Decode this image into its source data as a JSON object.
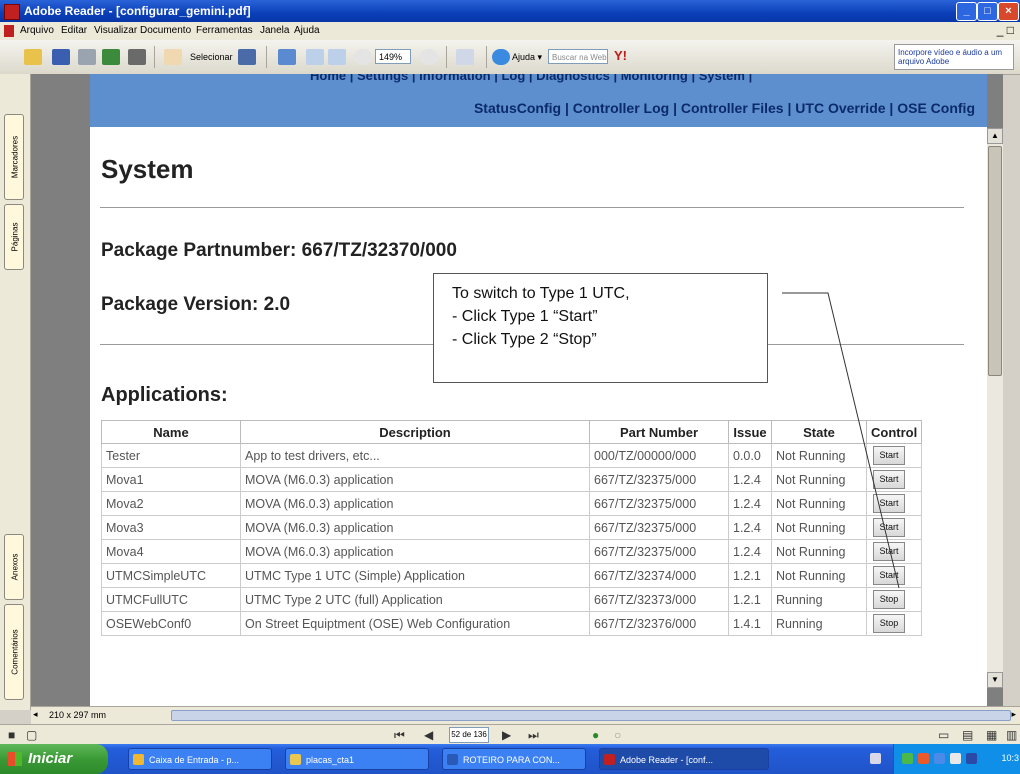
{
  "window": {
    "title": "Adobe Reader - [configurar_gemini.pdf]",
    "minimize": "_",
    "maximize": "□",
    "close": "×"
  },
  "menu": [
    "Arquivo",
    "Editar",
    "Visualizar",
    "Documento",
    "Ferramentas",
    "Janela",
    "Ajuda"
  ],
  "menu_mdi": "_ □",
  "toolbar": {
    "select_label": "Selecionar",
    "zoom_value": "149%",
    "help_label": "Ajuda",
    "search_placeholder": "Buscar na Web",
    "promo_text": "Incorpore vídeo e áudio a um arquivo Adobe"
  },
  "left_tabs": [
    "Marcadores",
    "Páginas",
    "Anexos",
    "Comentários"
  ],
  "page": {
    "nav_top": "Home | Settings | Information | Log | Diagnostics | Monitoring | System |",
    "nav_bottom": "StatusConfig | Controller Log | Controller Files | UTC Override | OSE Config",
    "title": "System",
    "package_partnumber": "Package Partnumber: 667/TZ/32370/000",
    "package_version": "Package Version: 2.0",
    "applications_heading": "Applications:",
    "callout": {
      "line1": "To switch to Type 1 UTC,",
      "line2": " - Click Type 1 “Start”",
      "line3": " - Click Type 2 “Stop”"
    },
    "table": {
      "headers": [
        "Name",
        "Description",
        "Part Number",
        "Issue",
        "State",
        "Control"
      ],
      "rows": [
        {
          "name": "Tester",
          "description": "App to test drivers, etc...",
          "part": "000/TZ/00000/000",
          "issue": "0.0.0",
          "state": "Not Running",
          "control": "Start"
        },
        {
          "name": "Mova1",
          "description": "MOVA (M6.0.3) application",
          "part": "667/TZ/32375/000",
          "issue": "1.2.4",
          "state": "Not Running",
          "control": "Start"
        },
        {
          "name": "Mova2",
          "description": "MOVA (M6.0.3) application",
          "part": "667/TZ/32375/000",
          "issue": "1.2.4",
          "state": "Not Running",
          "control": "Start"
        },
        {
          "name": "Mova3",
          "description": "MOVA (M6.0.3) application",
          "part": "667/TZ/32375/000",
          "issue": "1.2.4",
          "state": "Not Running",
          "control": "Start"
        },
        {
          "name": "Mova4",
          "description": "MOVA (M6.0.3) application",
          "part": "667/TZ/32375/000",
          "issue": "1.2.4",
          "state": "Not Running",
          "control": "Start"
        },
        {
          "name": "UTMCSimpleUTC",
          "description": "UTMC Type 1 UTC (Simple) Application",
          "part": "667/TZ/32374/000",
          "issue": "1.2.1",
          "state": "Not Running",
          "control": "Start"
        },
        {
          "name": "UTMCFullUTC",
          "description": "UTMC Type 2 UTC (full) Application",
          "part": "667/TZ/32373/000",
          "issue": "1.2.1",
          "state": "Running",
          "control": "Stop"
        },
        {
          "name": "OSEWebConf0",
          "description": "On Street Equiptment (OSE) Web Configuration",
          "part": "667/TZ/32376/000",
          "issue": "1.4.1",
          "state": "Running",
          "control": "Stop"
        }
      ]
    }
  },
  "status": {
    "page_size": "210 x 297 mm",
    "page_indicator": "52 de 136"
  },
  "taskbar": {
    "start": "Iniciar",
    "tasks": [
      "Caixa de Entrada - p...",
      "placas_cta1",
      "ROTEIRO PARA CON...",
      "Adobe Reader - [conf..."
    ],
    "clock": "10:3"
  },
  "colors": {
    "navbar": "#5d8fcf",
    "titlebar": "#0a3fb8",
    "taskbar": "#245edb"
  }
}
